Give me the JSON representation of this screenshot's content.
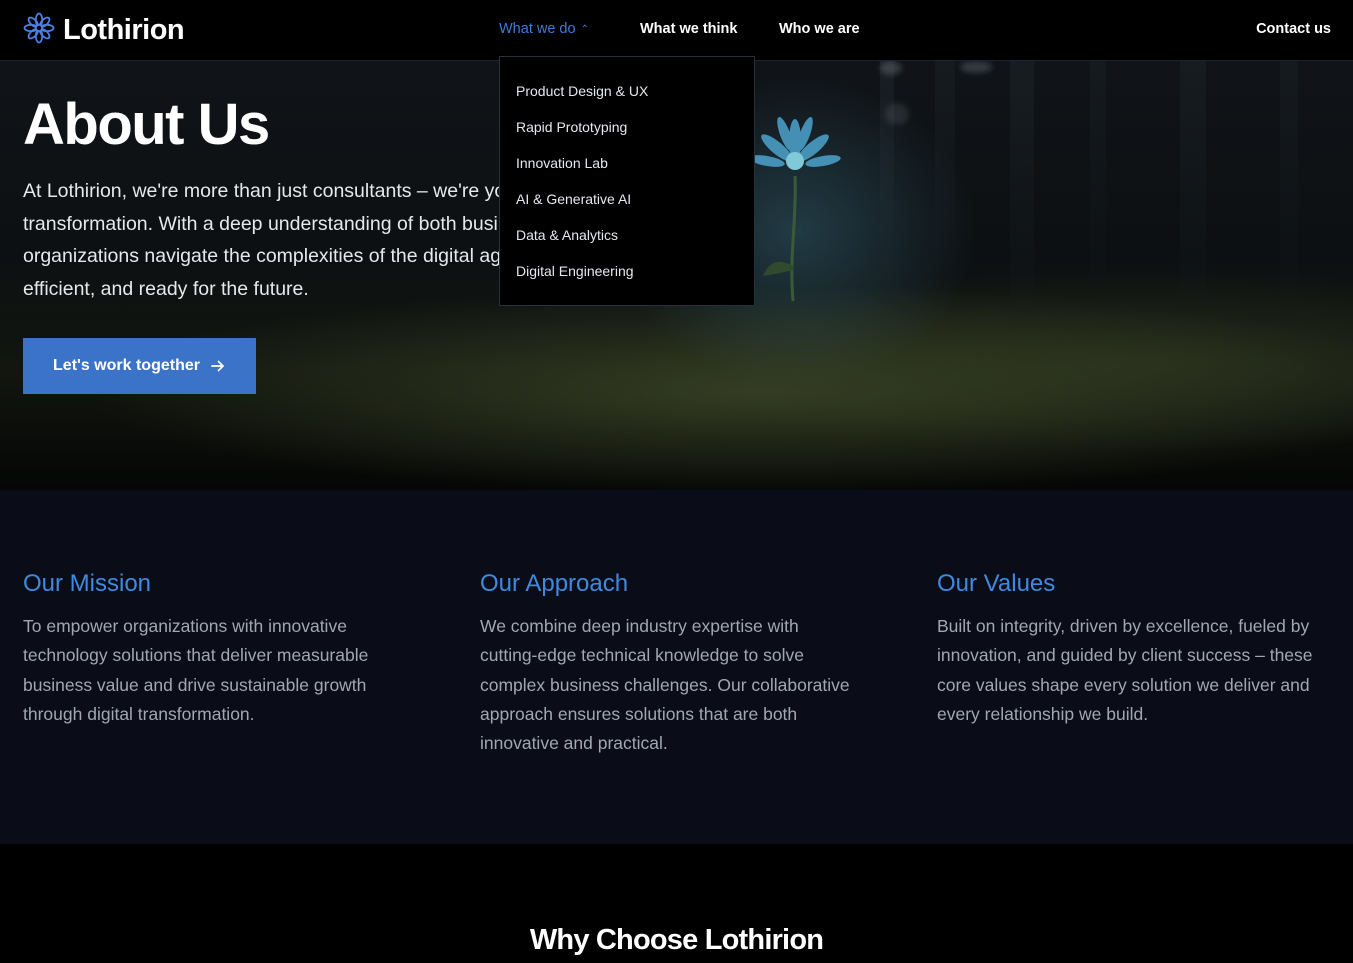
{
  "brand": {
    "name": "Lothirion"
  },
  "nav": {
    "items": [
      {
        "label": "What we do",
        "active": true
      },
      {
        "label": "What we think",
        "active": false
      },
      {
        "label": "Who we are",
        "active": false
      }
    ],
    "contact": "Contact us",
    "dropdown": [
      "Product Design & UX",
      "Rapid Prototyping",
      "Innovation Lab",
      "AI & Generative AI",
      "Data & Analytics",
      "Digital Engineering"
    ]
  },
  "hero": {
    "title": "About Us",
    "text": "At Lothirion, we're more than just consultants – we're your partners in digital transformation. With a deep understanding of both business and technology, we help organizations navigate the complexities of the digital age, making them more agile, efficient, and ready for the future.",
    "cta_label": "Let's work together"
  },
  "columns": [
    {
      "title": "Our Mission",
      "text": "To empower organizations with innovative technology solutions that deliver measurable business value and drive sustainable growth through digital transformation."
    },
    {
      "title": "Our Approach",
      "text": "We combine deep industry expertise with cutting-edge technical knowledge to solve complex business challenges. Our collaborative approach ensures solutions that are both innovative and practical."
    },
    {
      "title": "Our Values",
      "text": "Built on integrity, driven by excellence, fueled by innovation, and guided by client success – these core values shape every solution we deliver and every relationship we build."
    }
  ],
  "why": {
    "title": "Why Choose Lothirion"
  },
  "colors": {
    "accent": "#3f8ae0",
    "cta": "#3b73c8",
    "section_bg": "#0a0d17"
  }
}
